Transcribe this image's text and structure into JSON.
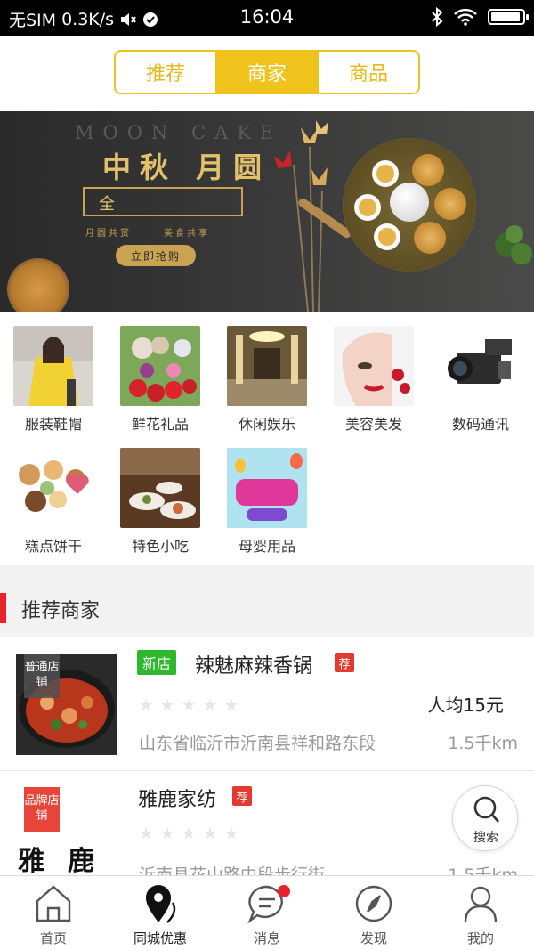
{
  "status_bar": {
    "carrier": "无SIM",
    "speed": "0.3K/s",
    "time": "16:04",
    "battery_level": 0.95
  },
  "segment_tabs": [
    {
      "label": "推荐",
      "active": false
    },
    {
      "label": "商家",
      "active": true
    },
    {
      "label": "商品",
      "active": false
    }
  ],
  "banner": {
    "english_title": "MOON CAKE",
    "title": "中秋 月圆",
    "frame_text": "全",
    "subtitle": "月圆共赏   美食共享",
    "cta": "立即抢购"
  },
  "categories": [
    {
      "label": "服装鞋帽",
      "icon": "clothing-photo"
    },
    {
      "label": "鲜花礼品",
      "icon": "flowers-photo"
    },
    {
      "label": "休闲娱乐",
      "icon": "hall-photo"
    },
    {
      "label": "美容美发",
      "icon": "beauty-photo"
    },
    {
      "label": "数码通讯",
      "icon": "camera-photo"
    },
    {
      "label": "糕点饼干",
      "icon": "cookies-photo"
    },
    {
      "label": "特色小吃",
      "icon": "snack-photo"
    },
    {
      "label": "母婴用品",
      "icon": "baby-photo"
    }
  ],
  "section": {
    "title": "推荐商家"
  },
  "merchants": [
    {
      "tag": "普通店铺",
      "badge_new": "新店",
      "name": "辣魅麻辣香锅",
      "badge_rec": "荐",
      "price": "人均15元",
      "rating": 0,
      "address": "山东省临沂市沂南县祥和路东段",
      "distance": "1.5千km",
      "tag_color": "#555555"
    },
    {
      "tag": "品牌店铺",
      "name": "雅鹿家纺",
      "badge_rec": "荐",
      "logo_text": "雅鹿",
      "rating": 0,
      "address": "沂南县花山路中段步行街",
      "distance": "1.5千km",
      "tag_color": "#e8453a"
    }
  ],
  "float_search": {
    "label": "搜索",
    "icon": "search-icon"
  },
  "bottom_nav": [
    {
      "label": "首页",
      "icon": "home-icon",
      "active": false
    },
    {
      "label": "同城优惠",
      "icon": "location-icon",
      "active": true
    },
    {
      "label": "消息",
      "icon": "message-icon",
      "active": false,
      "has_dot": true
    },
    {
      "label": "发现",
      "icon": "compass-icon",
      "active": false
    },
    {
      "label": "我的",
      "icon": "user-icon",
      "active": false
    }
  ],
  "colors": {
    "accent": "#f0c31c",
    "red": "#e8232b",
    "green_badge": "#2db82d"
  }
}
